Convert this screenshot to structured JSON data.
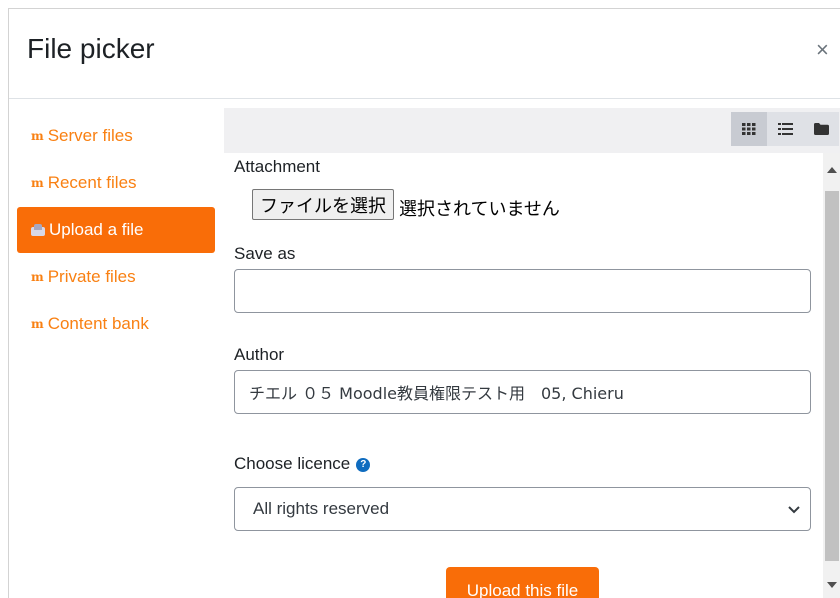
{
  "dialog": {
    "title": "File picker",
    "close_label": "×"
  },
  "sidebar": {
    "items": [
      {
        "label": "Server files",
        "icon": "moodle-icon",
        "active": false
      },
      {
        "label": "Recent files",
        "icon": "moodle-icon",
        "active": false
      },
      {
        "label": "Upload a file",
        "icon": "upload-icon",
        "active": true
      },
      {
        "label": "Private files",
        "icon": "moodle-icon",
        "active": false
      },
      {
        "label": "Content bank",
        "icon": "moodle-icon",
        "active": false
      }
    ],
    "icon_glyph": "m"
  },
  "toolbar": {
    "views": [
      {
        "name": "icons-view",
        "icon": "grid-icon"
      },
      {
        "name": "list-view",
        "icon": "list-icon"
      },
      {
        "name": "tree-view",
        "icon": "folder-icon"
      }
    ]
  },
  "form": {
    "attachment_label": "Attachment",
    "file_button": "ファイルを選択",
    "file_status": "選択されていません",
    "save_as_label": "Save as",
    "save_as_value": "",
    "author_label": "Author",
    "author_value": "チエル ０５ Moodle教員権限テスト用　05, Chieru",
    "licence_label": "Choose licence",
    "licence_help": "?",
    "licence_value": "All rights reserved",
    "submit_label": "Upload this file"
  },
  "colors": {
    "accent": "#f96d08",
    "link": "#f98012",
    "help": "#0f6cbf"
  }
}
